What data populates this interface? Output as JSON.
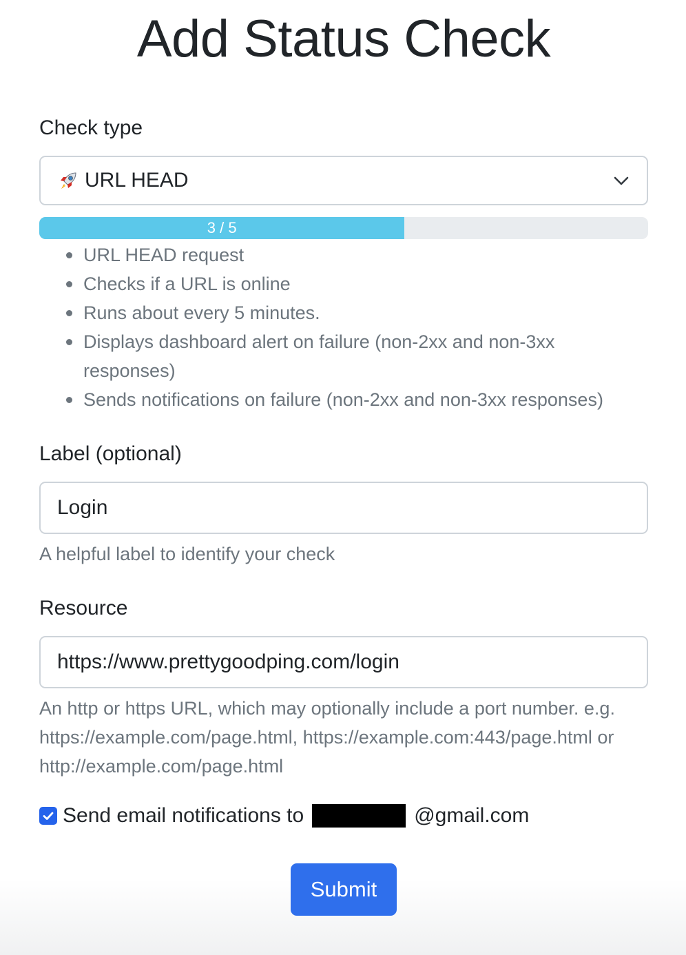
{
  "page": {
    "title": "Add Status Check"
  },
  "check_type": {
    "label": "Check type",
    "selected": "URL HEAD",
    "selected_icon": "rocket-icon",
    "dropdown_icon": "chevron-down-icon"
  },
  "progress": {
    "text": "3 / 5",
    "current": 3,
    "total": 5,
    "fraction": 0.6,
    "color": "#5bc8ea",
    "track_color": "#e9ecef"
  },
  "info": {
    "items": [
      "URL HEAD request",
      "Checks if a URL is online",
      "Runs about every 5 minutes.",
      "Displays dashboard alert on failure (non-2xx and non-3xx responses)",
      "Sends notifications on failure (non-2xx and non-3xx responses)"
    ]
  },
  "label_field": {
    "label": "Label (optional)",
    "value": "Login",
    "help": "A helpful label to identify your check"
  },
  "resource_field": {
    "label": "Resource",
    "value": "https://www.prettygoodping.com/login",
    "help": "An http or https URL, which may optionally include a port number. e.g. https://example.com/page.html, https://example.com:443/page.html or http://example.com/page.html"
  },
  "email_notifications": {
    "checked": true,
    "prefix": "Send email notifications to",
    "suffix": "@gmail.com"
  },
  "submit": {
    "label": "Submit",
    "color": "#2f6fec"
  }
}
